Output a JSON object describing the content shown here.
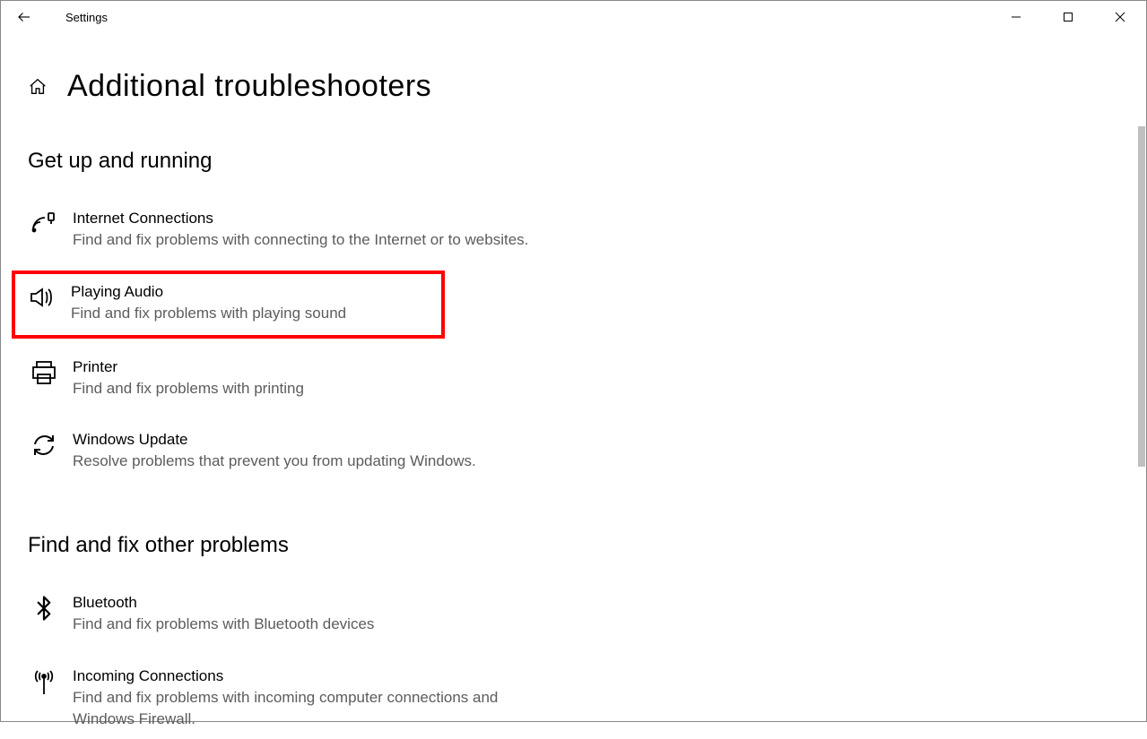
{
  "window": {
    "title": "Settings"
  },
  "page": {
    "title": "Additional troubleshooters"
  },
  "sections": {
    "getUp": {
      "title": "Get up and running",
      "items": [
        {
          "icon": "wifi-icon",
          "title": "Internet Connections",
          "desc": "Find and fix problems with connecting to the Internet or to websites."
        },
        {
          "icon": "audio-icon",
          "title": "Playing Audio",
          "desc": "Find and fix problems with playing sound",
          "highlight": true
        },
        {
          "icon": "printer-icon",
          "title": "Printer",
          "desc": "Find and fix problems with printing"
        },
        {
          "icon": "update-icon",
          "title": "Windows Update",
          "desc": "Resolve problems that prevent you from updating Windows."
        }
      ]
    },
    "other": {
      "title": "Find and fix other problems",
      "items": [
        {
          "icon": "bluetooth-icon",
          "title": "Bluetooth",
          "desc": "Find and fix problems with Bluetooth devices"
        },
        {
          "icon": "antenna-icon",
          "title": "Incoming Connections",
          "desc": "Find and fix problems with incoming computer connections and Windows Firewall."
        }
      ]
    }
  }
}
